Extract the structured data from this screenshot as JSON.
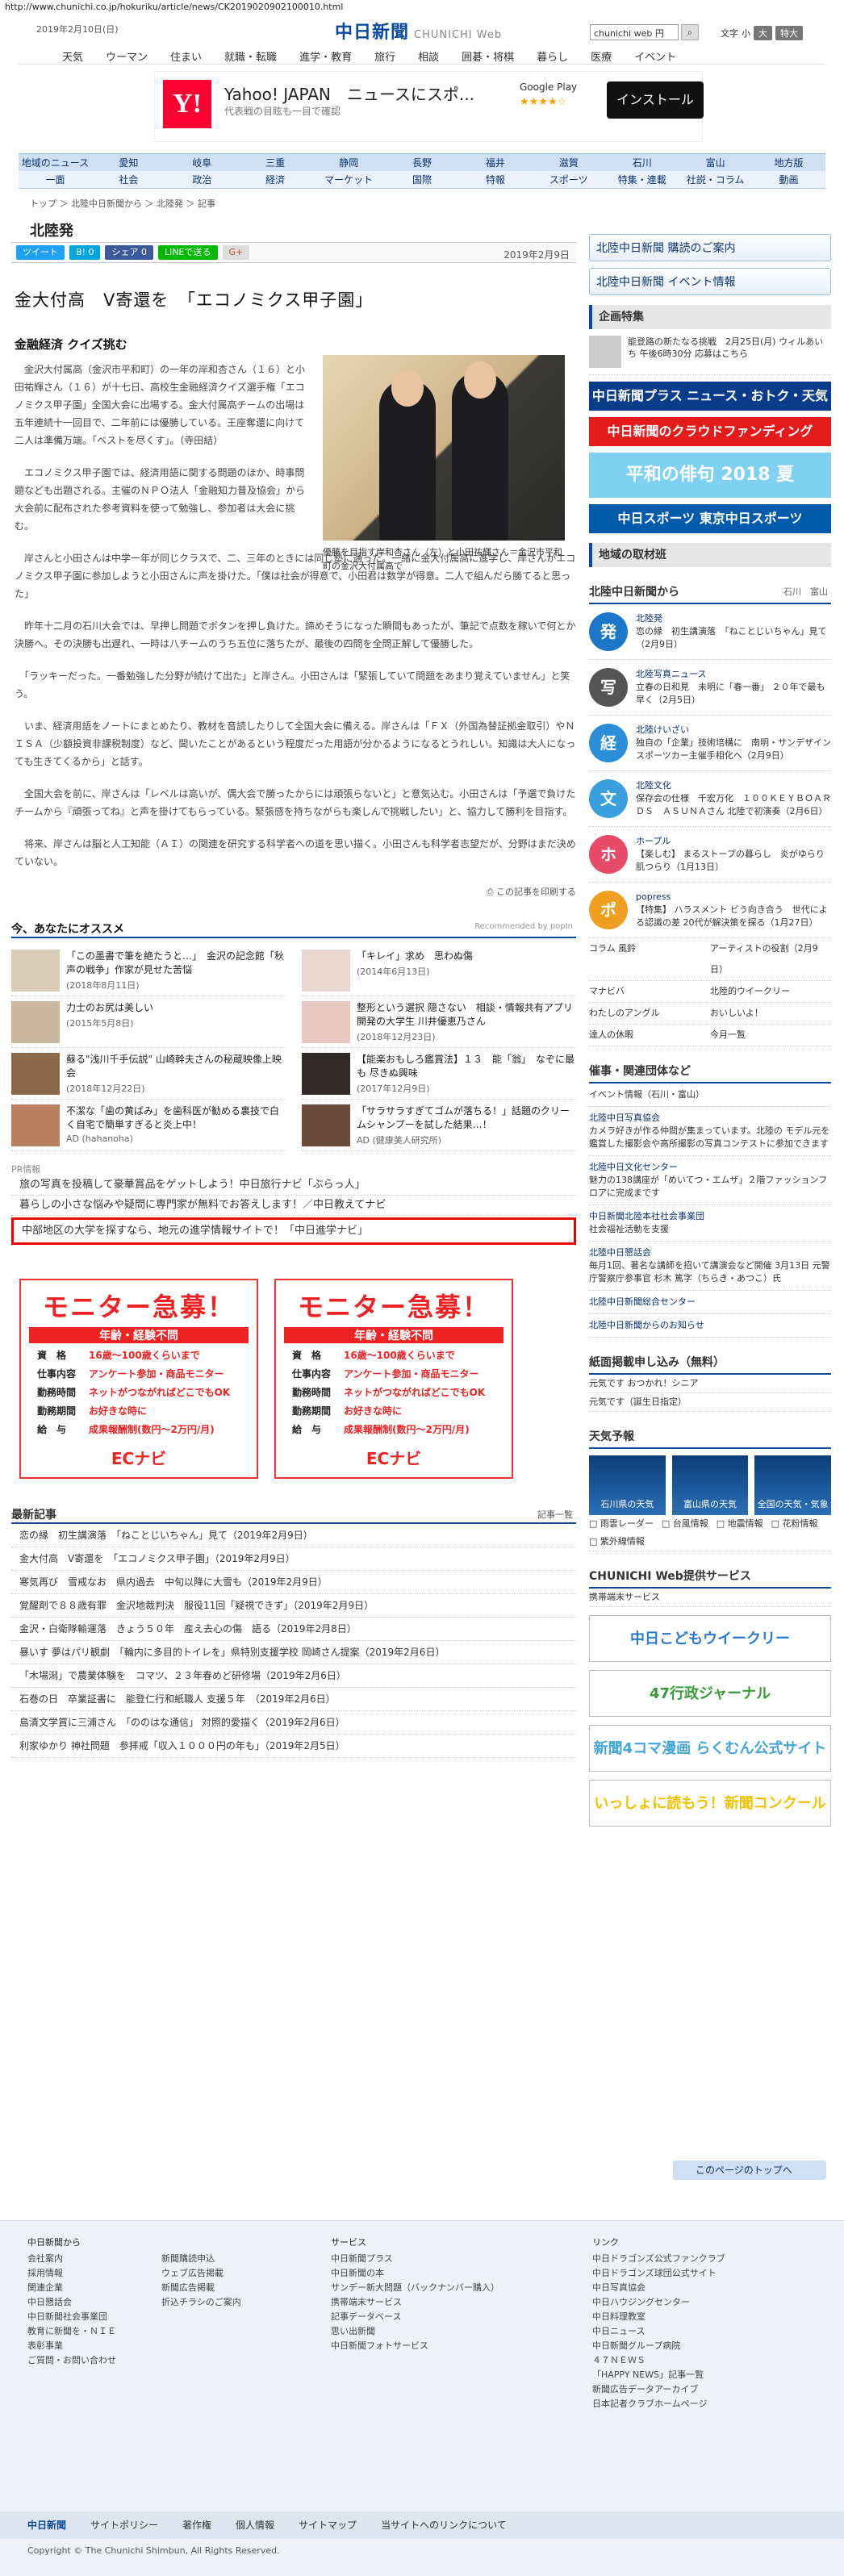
{
  "url": "http://www.chunichi.co.jp/hokuriku/article/news/CK2019020902100010.html",
  "header": {
    "date": "2019年2月10日(日)",
    "logo_jp": "中日新聞",
    "logo_en": "CHUNICHI Web",
    "search_value": "chunichi web 円",
    "font_label": "文字",
    "font_small": "小",
    "font_medium": "大",
    "font_large": "特大"
  },
  "gnav": [
    "天気",
    "ウーマン",
    "住まい",
    "就職・転職",
    "進学・教育",
    "旅行",
    "相談",
    "囲碁・将棋",
    "暮らし",
    "医療",
    "イベント"
  ],
  "ad": {
    "title": "Yahoo! JAPAN　ニュースにスポ...",
    "sub": "代表戦の目眩も一目で確認",
    "gplay": "Google Play",
    "stars": "★★★★☆",
    "install": "インストール"
  },
  "region_nav": [
    "地域のニュース",
    "愛知",
    "岐阜",
    "三重",
    "静岡",
    "長野",
    "福井",
    "滋賀",
    "石川",
    "富山",
    "地方版"
  ],
  "cat_nav": [
    "一面",
    "社会",
    "政治",
    "経済",
    "マーケット",
    "国際",
    "特報",
    "スポーツ",
    "特集・連載",
    "社説・コラム",
    "動画"
  ],
  "breadcrumb": "トップ ＞ 北陸中日新聞から ＞ 北陸発 ＞ 記事",
  "section_title": "北陸発",
  "share": {
    "tweet": "ツイート",
    "hatena": "B! 0",
    "fb": "シェア 0",
    "line": "LINEで送る",
    "gplus": "G+",
    "date": "2019年2月9日"
  },
  "article": {
    "headline": "金大付高　V寄還を　「エコノミクス甲子園」",
    "subhead": "金融経済 クイズ挑む",
    "caption": "優勝を目指す岸和杏さん（左）と小田祐輝さん＝金沢市平和町の金沢大付属高で",
    "paragraphs": [
      "　金沢大付属高（金沢市平和町）の一年の岸和杏さん（１６）と小田祐輝さん（１６）が十七日、高校生金融経済クイズ選手権「エコノミクス甲子園」全国大会に出場する。金大付属高チームの出場は五年連続十一回目で、二年前には優勝している。王座奪還に向けて二人は準備万端。「ベストを尽くす」。（寺田結）",
      "　エコノミクス甲子園では、経済用語に関する問題のほか、時事問題なども出題される。主催のＮＰＯ法人「金融知力普及協会」から大会前に配布された参考資料を使って勉強し、参加者は大会に挑む。",
      "　岸さんと小田さんは中学一年が同じクラスで、二、三年のときには同じ塾に通った。一緒に金大付属高に進学し、岸さんがエコノミクス甲子園に参加しようと小田さんに声を掛けた。「僕は社会が得意で、小田君は数学が得意。二人で組んだら勝てると思った」",
      "　昨年十二月の石川大会では、早押し問題でボタンを押し負けた。諦めそうになった瞬間もあったが、筆記で点数を稼いで何とか決勝へ。その決勝も出遅れ、一時は八チームのうち五位に落ちたが、最後の四問を全問正解して優勝した。",
      "　「ラッキーだった。一番勉強した分野が続けて出た」と岸さん。小田さんは「緊張していて問題をあまり覚えていません」と笑う。",
      "　いま、経済用語をノートにまとめたり、教材を音読したりして全国大会に備える。岸さんは「ＦＸ（外国為替証拠金取引）やＮＩＳＡ（少額投資非課税制度）など、聞いたことがあるという程度だった用語が分かるようになるとうれしい。知識は大人になっても生きてくるから」と話す。",
      "　全国大会を前に、岸さんは「レベルは高いが、偶大会で勝ったからには頑張らないと」と意気込む。小田さんは「予選で負けたチームから『頑張ってね』と声を掛けてもらっている。緊張感を持ちながらも楽しんで挑戦したい」と、協力して勝利を目指す。",
      "　将来、岸さんは脳と人工知能（ＡＩ）の関連を研究する科学者への道を思い描く。小田さんも科学者志望だが、分野はまだ決めていない。"
    ],
    "print_link": "この記事を印刷する"
  },
  "recommend": {
    "title": "今、あなたにオススメ",
    "by": "Recommended by popIn",
    "items": [
      {
        "title": "「この墨書で筆を絶たうと…」　金沢の記念館「秋声の戦争」作家が見せた苦悩",
        "date": "(2018年8月11日)"
      },
      {
        "title": "「キレイ」求め　思わぬ傷",
        "date": "(2014年6月13日)"
      },
      {
        "title": "力士のお尻は美しい",
        "date": "(2015年5月8日)"
      },
      {
        "title": "整形という選択 隠さない　相談・情報共有アプリ開発の大学生 川井優恵乃さん",
        "date": "(2018年12月23日)"
      },
      {
        "title": "蘇る\"浅川千手伝説\" 山崎幹夫さんの秘蔵映像上映会",
        "date": "(2018年12月22日)"
      },
      {
        "title": "【能楽おもしろ鑑賞法】１３　能「翁」　なぞに最も 尽きぬ興味",
        "date": "(2017年12月9日)"
      },
      {
        "title": "不潔な「歯の黄ばみ」を歯科医が勧める裏技で白く自宅で簡単すぎると炎上中！",
        "date": "AD (hahanoha)"
      },
      {
        "title": "「サラサラすぎてゴムが落ちる！」話題のクリームシャンプーを試した結果…！",
        "date": "AD (健康美人研究所)"
      }
    ]
  },
  "pr": {
    "label": "PR情報",
    "items": [
      "旅の写真を投稿して豪華賞品をゲットしよう！中日旅行ナビ「ぶらっ人」",
      "暮らしの小さな悩みや疑問に専門家が無料でお答えします！／中日教えてナビ",
      "中部地区の大学を探すなら、地元の進学情報サイトで！「中日進学ナビ」"
    ]
  },
  "monitor": {
    "head": "モニター急募！",
    "bar": "年齢・経験不問",
    "rows": [
      {
        "k": "資　格",
        "v": "16歳～100歳くらいまで"
      },
      {
        "k": "仕事内容",
        "v": "アンケート参加・商品モニター"
      },
      {
        "k": "勤務時間",
        "v": "ネットがつながればどこでもOK"
      },
      {
        "k": "勤務期間",
        "v": "お好きな時に"
      },
      {
        "k": "給　与",
        "v": "成果報酬制(数円～2万円/月)"
      }
    ],
    "logo": "ECナビ"
  },
  "latest": {
    "title": "最新記事",
    "more": "記事一覧",
    "items": [
      "恋の縁　初生講演落　「ねことじいちゃん」見て（2019年2月9日）",
      "金大付高　V寄還を　「エコノミクス甲子園」（2019年2月9日）",
      "寒気再び　雪戒なお　県内過去　中旬以降に大雪も（2019年2月9日）",
      "覚醒剤で８８歳有罪　金沢地裁判決　服役11回「疑視できず」（2019年2月9日）",
      "金沢・白衛隊輸運落　きょう５０年　産え去心の傷　語る（2019年2月8日）",
      "暴いす 夢はパリ観劇　「輪内に多目的トイレを」県特別支援学校 岡崎さん提案（2019年2月6日）",
      "「木場潟」で農業体験を　コマツ、２３年春めど研修場（2019年2月6日）",
      "石巻の日　卒業証書に　能登仁行和紙職人 支援５年　（2019年2月6日）",
      "島清文学賞に三浦さん　「ののはな通信」 対照的愛描く（2019年2月6日）",
      "利家ゆかり 神社問題　参拝戒「収入１０００円の年も」（2019年2月5日）"
    ]
  },
  "side": {
    "btn1": "北陸中日新聞 購読のご案内",
    "btn2": "北陸中日新聞 イベント情報",
    "feature_title": "企画特集",
    "feature_item": "能登路の新たなる挑戦　2月25日(月) ウィルあいち 午後6時30分 応募はこちら",
    "banners": [
      "中日新聞プラス ニュース・おトク・天気",
      "中日新聞のクラウドファンディング",
      "平和の俳句 2018 夏",
      "中日スポーツ 東京中日スポーツ"
    ],
    "region_ad": "地域の取材班",
    "hokuriku_title": "北陸中日新聞から",
    "hokuriku_sub": "石川　富山",
    "news": [
      {
        "icon": "発",
        "color": "#1b78c8",
        "head": "北陸発",
        "text": "恋の縁　初生講演落　「ねことじいちゃん」見て（2月9日）"
      },
      {
        "icon": "写",
        "color": "#555",
        "head": "北陸写真ニュース",
        "text": "立春の日和見　未明に「春一番」 ２０年で最も早く（2月5日）"
      },
      {
        "icon": "経",
        "color": "#2a8fd8",
        "head": "北陸けいざい",
        "text": "独自の「企業」技術培構に　南明・サンデザイン　スポーツカー主催手相化へ（2月9日）"
      },
      {
        "icon": "文",
        "color": "#3a9fdf",
        "head": "北陸文化",
        "text": "保存会の仕様　千宏万化　１００ＫＥＹＢＯＡＲＤＳ　ＡＳＵＮＡさん 北陸で初演奏（2月6日）"
      },
      {
        "icon": "ホ",
        "color": "#e84a6a",
        "head": "ホープル",
        "text": "【楽しむ】 まるストープの暮らし　炎がゆらり 肌つらり（1月13日）"
      },
      {
        "icon": "ポ",
        "color": "#f0a020",
        "head": "popress",
        "text": "【特集】 ハラスメント ビう向き合う　世代による認識の差 20代が解決策を探る（1月27日）"
      }
    ],
    "columns": [
      {
        "left": "コラム 風鈴",
        "right": "アーティストの役割（2月9日）"
      },
      {
        "left": "マナビバ",
        "right": "北陸的ウイークリー"
      },
      {
        "left": "わたしのアングル",
        "right": "おいしいよ！"
      },
      {
        "left": "達人の休暇",
        "right": "今月一覧"
      }
    ],
    "events_title": "催事・関連団体など",
    "events_sub": "イベント情報（石川・富山）",
    "events": [
      {
        "head": "北陸中日写真協会",
        "text": "カメラ好きが作る仲間が集まっています。北陸の モデル元を鑑賞した撮影会や高所撮影の写真コンテストに参加できます"
      },
      {
        "head": "北陸中日文化センター",
        "text": "魅力の138講座が「めいてつ・エムザ」２階ファッションフロアに完成まです"
      },
      {
        "head": "中日新聞北陸本社社会事業団",
        "text": "社会福祉活動を支援"
      },
      {
        "head": "北陸中日懇話会",
        "text": "毎月1回、著名な講師を招いて講演会など開催 3月13日 元警庁警察庁参事官 杉木 篤字（ちらき・あつこ）氏"
      },
      {
        "head": "北陸中日新聞総合センター",
        "text": ""
      },
      {
        "head": "北陸中日新聞からのお知らせ",
        "text": ""
      }
    ],
    "ads_title": "紙面掲載申し込み（無料）",
    "ads_items": [
      "元気です おつかれ！シニア",
      "元気です（誕生日指定）"
    ],
    "weather_title": "天気予報",
    "weather": [
      "石川県の天気",
      "富山県の天気",
      "全国の天気・気象"
    ],
    "weather_links": [
      "雨雲レーダー",
      "台風情報",
      "地震情報",
      "花粉情報",
      "紫外線情報"
    ],
    "service_title": "CHUNICHI Web提供サービス",
    "service_item": "携帯端末サービス",
    "ad_banners": [
      "中日こどもウイークリー",
      "47行政ジャーナル",
      "新聞4コマ漫画 らくむん公式サイト",
      "いっしょに読もう！新聞コンクール"
    ]
  },
  "footer": {
    "to_top": "このページのトップへ",
    "cols": [
      {
        "h": "中日新聞から",
        "items": [
          "会社案内",
          "採用情報",
          "関連企業",
          "中日懇話会",
          "中日新聞社会事業団",
          "教育に新聞を・ＮＩＥ",
          "表彰事業",
          "ご質問・お問い合わせ"
        ]
      },
      {
        "h": "",
        "items": [
          "新聞購読申込",
          "ウェブ広告掲載",
          "新聞広告掲載",
          "折込チラシのご案内"
        ]
      },
      {
        "h": "サービス",
        "items": [
          "中日新聞プラス",
          "中日新聞の本",
          "サンデー新大問題（バックナンバー購入）",
          "携帯端末サービス",
          "記事データベース",
          "思い出新聞",
          "中日新聞フォトサービス"
        ]
      },
      {
        "h": "リンク",
        "items": [
          "中日ドラゴンズ公式ファンクラブ",
          "中日ドラゴンズ球団公式サイト",
          "中日写真協会",
          "中日ハウジングセンター",
          "中日料理教室",
          "中日ニュース",
          "中日新聞グループ病院",
          "４７ＮＥＷＳ",
          "「HAPPY NEWS」記事一覧",
          "新聞広告データアーカイブ",
          "日本記者クラブホームページ"
        ]
      }
    ],
    "bar": [
      "中日新聞",
      "サイトポリシー",
      "著作権",
      "個人情報",
      "サイトマップ",
      "当サイトへのリンクについて"
    ],
    "copyright": "Copyright © The Chunichi Shimbun, All Rights Reserved."
  }
}
